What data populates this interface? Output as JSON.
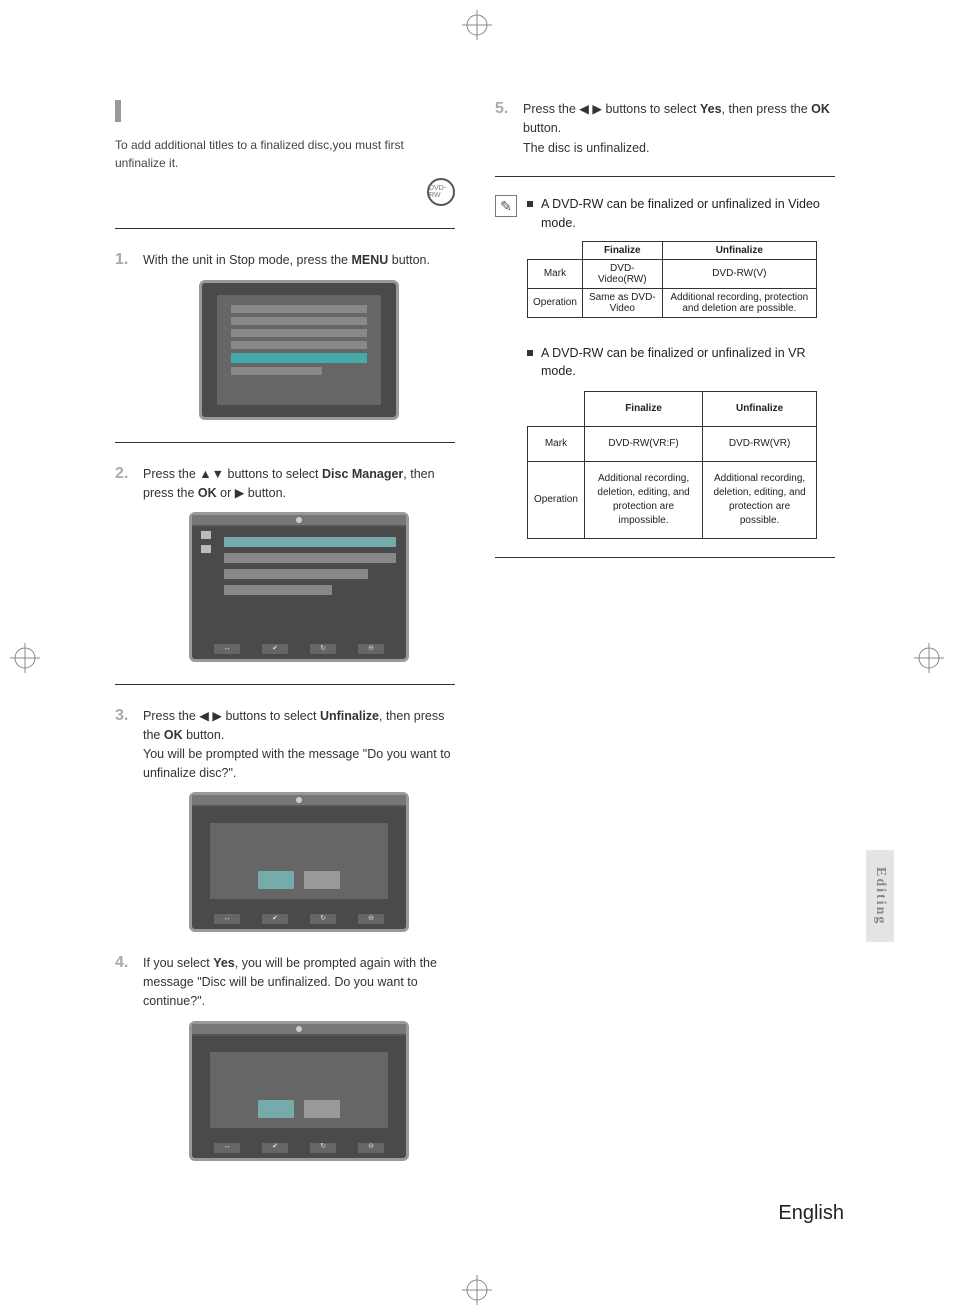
{
  "left": {
    "intro": "To add additional titles to a finalized disc,you must first unfinalize it.",
    "disc_label": "DVD-RW",
    "step1": {
      "pre": "With the unit in Stop mode, press the ",
      "btn": "MENU",
      "post": " button."
    },
    "step2": {
      "pre": "Press the ",
      "arrow": "▲▼",
      "mid": " buttons to select ",
      "sel": "Disc Manager",
      "mid2": ", then press the ",
      "btn": "OK",
      "or": " or ",
      "arrow2": "▶",
      "post": " button."
    },
    "step3": {
      "pre": "Press the ",
      "arrow": "◀ ▶",
      "mid": " buttons to select ",
      "sel": "Unfinalize",
      "mid2": ", then press the ",
      "btn": "OK",
      "post": " button.",
      "line2": "You will be prompted with the message \"Do you want to unfinalize disc?\"."
    },
    "step4": {
      "pre": "If you select ",
      "sel": "Yes",
      "post": ", you will be prompted again with the message \"Disc will be unfinalized. Do you want to continue?\"."
    }
  },
  "right": {
    "step5": {
      "pre": "Press the ",
      "arrow": "◀ ▶",
      "mid": " buttons to select ",
      "sel": "Yes",
      "mid2": ", then press the ",
      "btn": "OK",
      "post": " button.",
      "line2": "The disc is unfinalized."
    },
    "note1": "A DVD-RW can be finalized or unfinalized in Video mode.",
    "table1": {
      "h1": "Finalize",
      "h2": "Unfinalize",
      "r1c0": "Mark",
      "r1c1": "DVD-Video(RW)",
      "r1c2": "DVD-RW(V)",
      "r2c0": "Operation",
      "r2c1": "Same as DVD-Video",
      "r2c2": "Additional recording, protection and deletion are possible."
    },
    "note2": "A DVD-RW can be finalized or unfinalized in VR mode.",
    "table2": {
      "h1": "Finalize",
      "h2": "Unfinalize",
      "r1c0": "Mark",
      "r1c1": "DVD-RW(VR:F)",
      "r1c2": "DVD-RW(VR)",
      "r2c0": "Operation",
      "r2c1": "Additional recording, deletion, editing, and protection are impossible.",
      "r2c2": "Additional recording, deletion, editing, and protection are possible."
    }
  },
  "side_tab": "Editing",
  "footer": "English",
  "screens": {
    "footer_btns": [
      "↔",
      "✔",
      "↻",
      "⊖"
    ]
  }
}
